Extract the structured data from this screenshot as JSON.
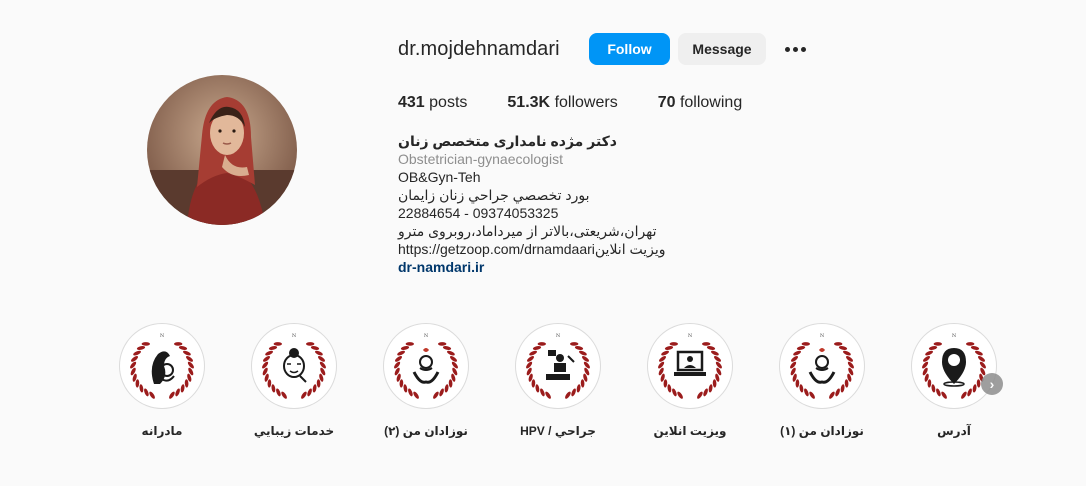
{
  "profile": {
    "username": "dr.mojdehnamdari",
    "follow_label": "Follow",
    "message_label": "Message"
  },
  "stats": {
    "posts_count": "431",
    "posts_label": "posts",
    "followers_count": "51.3K",
    "followers_label": "followers",
    "following_count": "70",
    "following_label": "following"
  },
  "bio": {
    "full_name": "دکتر مژده نامداری متخصص زنان",
    "category": "Obstetrician-gynaecologist",
    "line1": "OB&Gyn-Teh",
    "line2": "بورد تخصصي جراحي زنان زايمان",
    "line3": "22884654 - 09374053325",
    "line4": "تهران،شریعتی،بالاتر از میرداماد،روبروی مترو",
    "line5": "https://getzoop.com/drnamdaariویزیت انلاین",
    "website": "dr-namdari.ir"
  },
  "highlights": [
    {
      "label": "مادرانه",
      "icon": "mother-baby-icon"
    },
    {
      "label": "خدمات زيبايي",
      "icon": "beauty-face-icon"
    },
    {
      "label": "نوزادان من (۲)",
      "icon": "baby-hands-icon"
    },
    {
      "label": "HPV / جراحي",
      "icon": "surgery-icon"
    },
    {
      "label": "ويزيت انلاين",
      "icon": "online-visit-icon"
    },
    {
      "label": "نوزادان من (۱)",
      "icon": "baby-hands-icon"
    },
    {
      "label": "آدرس",
      "icon": "location-pin-icon"
    }
  ],
  "colors": {
    "follow_button": "#0095f6",
    "laurel": "#9b1c1c",
    "link": "#00376b"
  }
}
